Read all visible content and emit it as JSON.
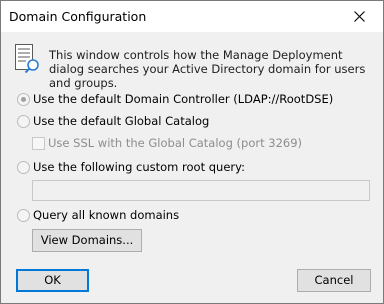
{
  "window": {
    "title": "Domain Configuration",
    "close_icon": "close-icon"
  },
  "info": {
    "icon": "server-search-icon",
    "text": "This window controls how the Manage Deployment dialog searches your Active Directory domain for users and groups."
  },
  "options": {
    "default_dc": {
      "label": "Use the default Domain Controller (LDAP://RootDSE)",
      "selected": true,
      "enabled": false
    },
    "default_gc": {
      "label": "Use the default Global Catalog",
      "selected": false,
      "enabled": false
    },
    "use_ssl": {
      "label": "Use SSL with the Global Catalog (port 3269)",
      "checked": false,
      "enabled": false
    },
    "custom_query": {
      "label": "Use the following custom root query:",
      "selected": false,
      "enabled": false,
      "value": ""
    },
    "all_domains": {
      "label": "Query all known domains",
      "selected": false,
      "enabled": false
    }
  },
  "buttons": {
    "view_domains": "View Domains...",
    "ok": "OK",
    "cancel": "Cancel"
  },
  "colors": {
    "accent": "#0078d7",
    "background": "#f0f0f0",
    "disabled_text": "#8d8d8d"
  }
}
